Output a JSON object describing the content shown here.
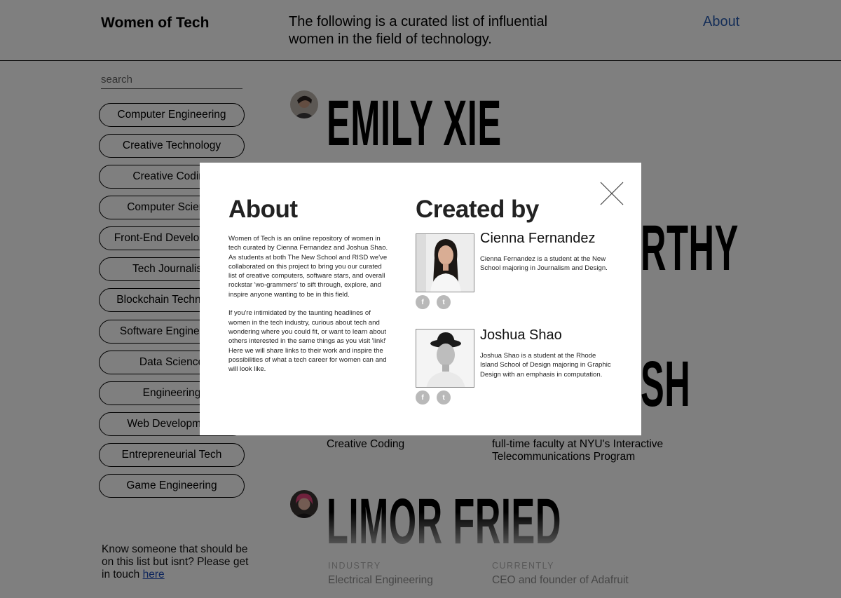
{
  "header": {
    "brand": "Women of Tech",
    "tagline": "The following is a curated list of influential women in the field of technology.",
    "about_link": "About"
  },
  "sidebar": {
    "search_placeholder": "search",
    "categories": [
      "Computer Engineering",
      "Creative Technology",
      "Creative Coding",
      "Computer Science",
      "Front-End Development",
      "Tech Journalism",
      "Blockchain Technology",
      "Software Engineering",
      "Data Science",
      "Engineering",
      "Web Development",
      "Entrepreneurial Tech",
      "Game Engineering"
    ],
    "suggest_text": "Know someone that should be on this list but isnt? Please get in touch",
    "suggest_link": "here"
  },
  "profiles": {
    "p1": {
      "name": "EMILY XIE"
    },
    "p2": {
      "name_partial": "RTHY"
    },
    "p3": {
      "name_partial": "SH",
      "industry_value": "Creative Coding",
      "currently_value": "full-time faculty at NYU's Interactive Telecommunications Program"
    },
    "p4": {
      "name": "LIMOR FRIED",
      "industry_label": "INDUSTRY",
      "industry_value": "Electrical Engineering",
      "currently_label": "CURRENTLY",
      "currently_value": "CEO and founder of Adafruit"
    }
  },
  "modal": {
    "about_title": "About",
    "about_p1": "Women of Tech is an online repository of women in tech curated by Cienna Fernandez and Joshua Shao. As students at both The New School and RISD we've collaborated on this project to bring you our curated list of creative computers, software stars, and overall rockstar 'wo-grammers' to sift through, explore, and inspire anyone wanting to be in this field.",
    "about_p2": "If you're intimidated by the taunting headlines of women in the tech industry, curious about tech and wondering where you could fit, or want to learn about others interested in the same things as you visit 'link!' Here we will share links to their work and inspire the possibilities of what a tech career for women can and will look like.",
    "created_title": "Created by",
    "creators": [
      {
        "name": "Cienna Fernandez",
        "bio": "Cienna Fernandez is a student at the New School majoring in Journalism and Design."
      },
      {
        "name": "Joshua Shao",
        "bio": "Joshua Shao is a student at the Rhode Island School of Design majoring in Graphic Design with an emphasis in computation."
      }
    ],
    "social_facebook": "f",
    "social_twitter": "t"
  },
  "colors": {
    "link_blue": "#2a5db0",
    "overlay": "rgba(0,0,0,0.5)"
  }
}
